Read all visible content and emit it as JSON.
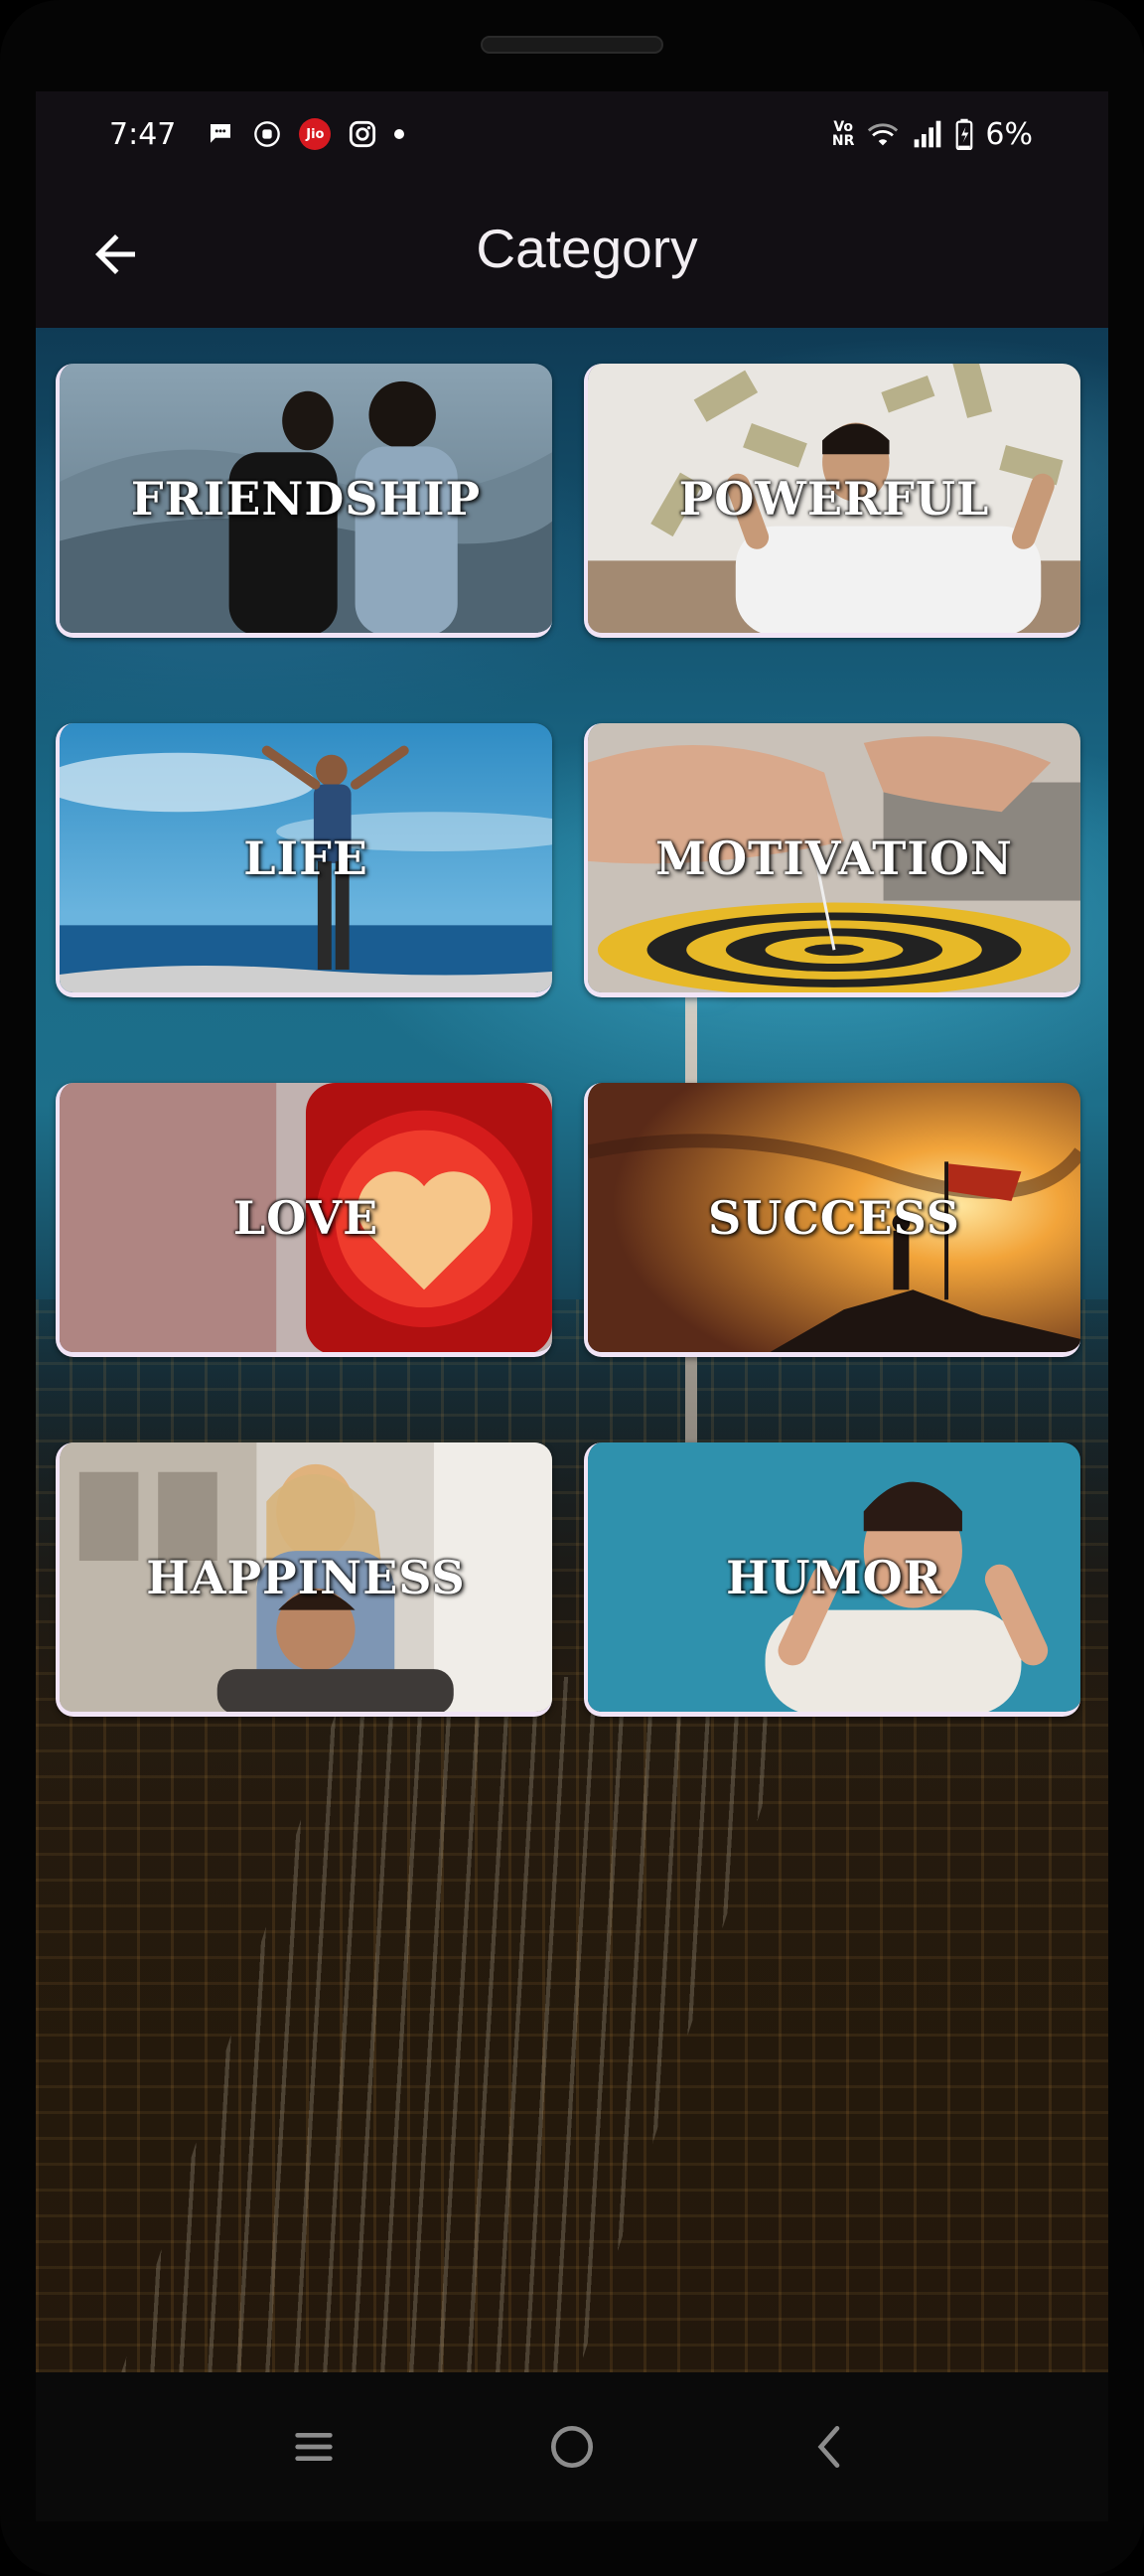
{
  "status_bar": {
    "time": "7:47",
    "jio_label": "Jio",
    "volte_top": "Vo",
    "volte_bottom": "NR",
    "battery_percent": "6%"
  },
  "app_bar": {
    "title": "Category"
  },
  "categories": [
    {
      "label": "FRIENDSHIP"
    },
    {
      "label": "POWERFUL"
    },
    {
      "label": "LIFE"
    },
    {
      "label": "MOTIVATION"
    },
    {
      "label": "LOVE"
    },
    {
      "label": "SUCCESS"
    },
    {
      "label": "HAPPINESS"
    },
    {
      "label": "HUMOR"
    }
  ],
  "colors": {
    "app_bar_bg": "#120f14",
    "card_border": "#f1e4f6",
    "label_text": "#ffffff"
  }
}
